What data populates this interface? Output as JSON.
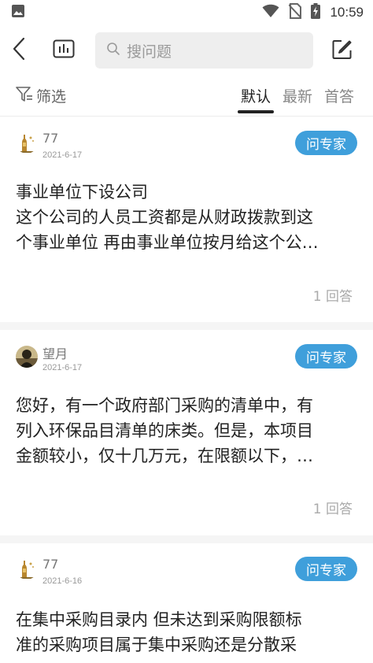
{
  "status_bar": {
    "time": "10:59",
    "icons": [
      "image-icon",
      "wifi-icon",
      "no-sim-icon",
      "battery-charging-icon"
    ]
  },
  "header": {
    "back_icon": "chevron-left-icon",
    "chart_icon": "bar-chart-icon",
    "search_placeholder": "搜问题",
    "edit_icon": "edit-icon"
  },
  "filter_bar": {
    "filter_label": "筛选",
    "tabs": [
      {
        "label": "默认",
        "active": true
      },
      {
        "label": "最新",
        "active": false
      },
      {
        "label": "首答",
        "active": false
      }
    ]
  },
  "questions": [
    {
      "username": "77",
      "date": "2021-6-17",
      "expert_label": "问专家",
      "lines": [
        "事业单位下设公司",
        "这个公司的人员工资都是从财政拨款到这",
        "个事业单位 再由事业单位按月给这个公…"
      ],
      "answers": "1 回答"
    },
    {
      "username": "望月",
      "date": "2021-6-17",
      "expert_label": "问专家",
      "lines": [
        "您好，有一个政府部门采购的清单中，有",
        "列入环保品目清单的床类。但是，本项目",
        "金额较小，仅十几万元，在限额以下，…"
      ],
      "answers": "1 回答"
    },
    {
      "username": "77",
      "date": "2021-6-16",
      "expert_label": "问专家",
      "lines": [
        "在集中采购目录内 但未达到采购限额标",
        "准的采购项目属于集中采购还是分散采"
      ],
      "answers": ""
    }
  ],
  "colors": {
    "accent": "#3f9fdb",
    "text": "#222222",
    "muted": "#999999"
  }
}
